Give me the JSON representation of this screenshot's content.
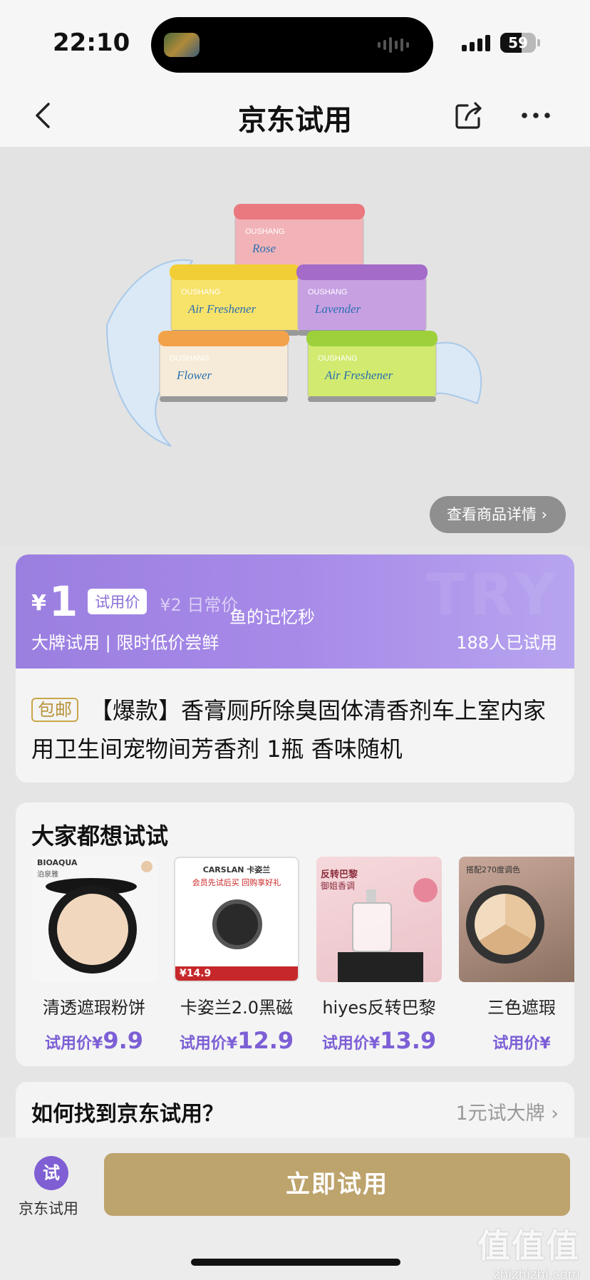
{
  "status_bar": {
    "time": "22:10",
    "battery": "59",
    "battery_level": 0.59
  },
  "nav": {
    "title": "京东试用"
  },
  "product": {
    "detail_button": "查看商品详情 ›",
    "tins": [
      {
        "brand": "OUSHANG",
        "label": "Rose",
        "lid": "#e9797f",
        "body": "#f2b3b8"
      },
      {
        "brand": "OUSHANG",
        "label": "Air Freshener",
        "lid": "#f1ce35",
        "body": "#f7e26a"
      },
      {
        "brand": "OUSHANG",
        "label": "Lavender",
        "lid": "#a46bc9",
        "body": "#c7a0e2"
      },
      {
        "brand": "OUSHANG",
        "label": "Flower",
        "lid": "#f2a34a",
        "body": "#f6ebd8"
      },
      {
        "brand": "OUSHANG",
        "label": "Air Freshener",
        "lid": "#9dd03a",
        "body": "#d2ea6f"
      }
    ]
  },
  "price_banner": {
    "currency": "¥",
    "price": "1",
    "trial_tag": "试用价",
    "original_price": "¥2 日常价",
    "user_watermark": "鱼的记忆秒",
    "slogan": "大牌试用 | 限时低价尝鲜",
    "tried_count": "188人已试用",
    "bg_watermark": "TRY"
  },
  "product_title": {
    "badge": "包邮",
    "text": "【爆款】香膏厕所除臭固体清香剂车上室内家用卫生间宠物间芳香剂 1瓶 香味随机"
  },
  "recommend": {
    "title": "大家都想试试",
    "price_prefix": "试用价¥",
    "items": [
      {
        "name": "清透遮瑕粉饼",
        "price": "9.9",
        "img_text_top": "BIOAQUA",
        "img_text_sub": "泊泉雅",
        "img_text_bottom": ""
      },
      {
        "name": "卡姿兰2.0黑磁",
        "price": "12.9",
        "img_text_top": "CARSLAN 卡姿兰",
        "img_text_sub": "会员先试后买 回购享好礼",
        "img_text_bottom": "¥14.9"
      },
      {
        "name": "hiyes反转巴黎",
        "price": "13.9",
        "img_text_top": "反转巴黎",
        "img_text_sub": "御姐香调",
        "img_text_bottom": ""
      },
      {
        "name": "三色遮瑕",
        "price": "",
        "img_text_top": "搭配270度调色",
        "img_text_sub": "",
        "img_text_bottom": ""
      }
    ]
  },
  "how_to": {
    "title": "如何找到京东试用？",
    "link": "1元试大牌 ›"
  },
  "bottom": {
    "shop_logo": "试",
    "shop_label": "京东试用",
    "try_button": "立即试用"
  },
  "watermark_site": {
    "logo": "值值值",
    "url": "zhizhizhi.com"
  },
  "colors": {
    "accent_purple": "#9b7fe0",
    "gold": "#bda36c"
  }
}
